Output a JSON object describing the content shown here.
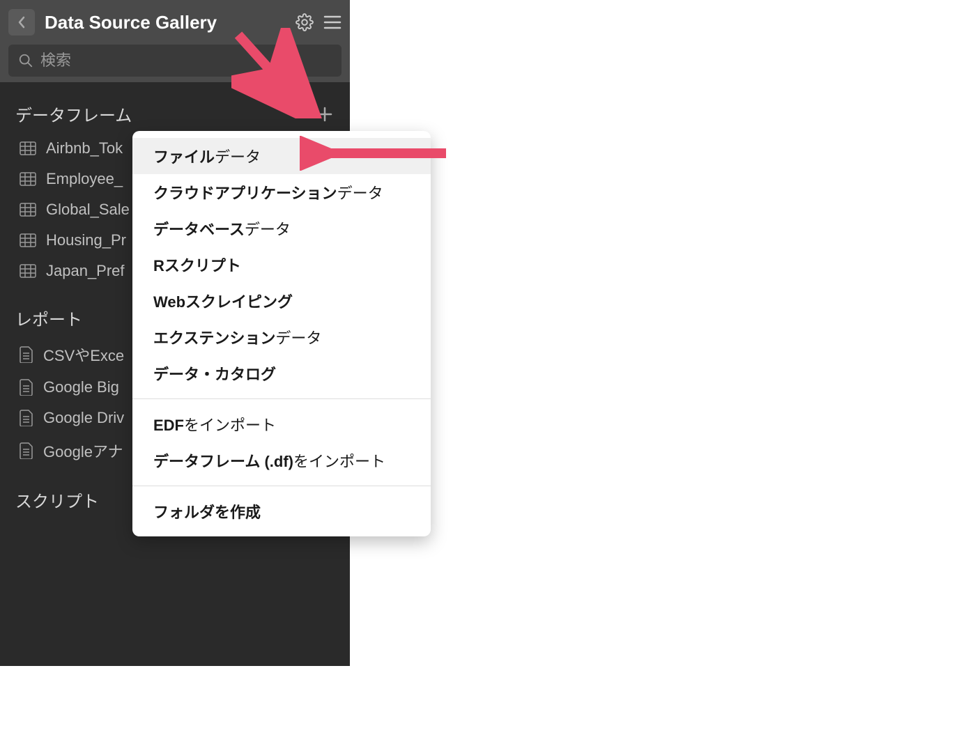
{
  "header": {
    "title": "Data Source Gallery",
    "search_placeholder": "検索"
  },
  "sections": {
    "dataframes": {
      "title": "データフレーム",
      "items": [
        "Airbnb_Tok",
        "Employee_",
        "Global_Sale",
        "Housing_Pr",
        "Japan_Pref"
      ]
    },
    "reports": {
      "title": "レポート",
      "items": [
        "CSVやExce",
        "Google Big",
        "Google Driv",
        "Googleアナ"
      ]
    },
    "scripts": {
      "title": "スクリプト"
    }
  },
  "menu": {
    "items": [
      {
        "bold": "ファイル",
        "normal": "データ",
        "highlighted": true
      },
      {
        "bold": "クラウドアプリケーション",
        "normal": "データ"
      },
      {
        "bold": "データベース",
        "normal": "データ"
      },
      {
        "bold": "Rスクリプト",
        "normal": ""
      },
      {
        "bold": "Webスクレイピング",
        "normal": ""
      },
      {
        "bold": "エクステンション",
        "normal": "データ"
      },
      {
        "bold": "データ・カタログ",
        "normal": ""
      }
    ],
    "group2": [
      {
        "bold": "EDF",
        "normal": "をインポート"
      },
      {
        "bold": "データフレーム (.df)",
        "normal": "をインポート"
      }
    ],
    "group3": [
      {
        "bold": "フォルダを作成",
        "normal": ""
      }
    ]
  }
}
